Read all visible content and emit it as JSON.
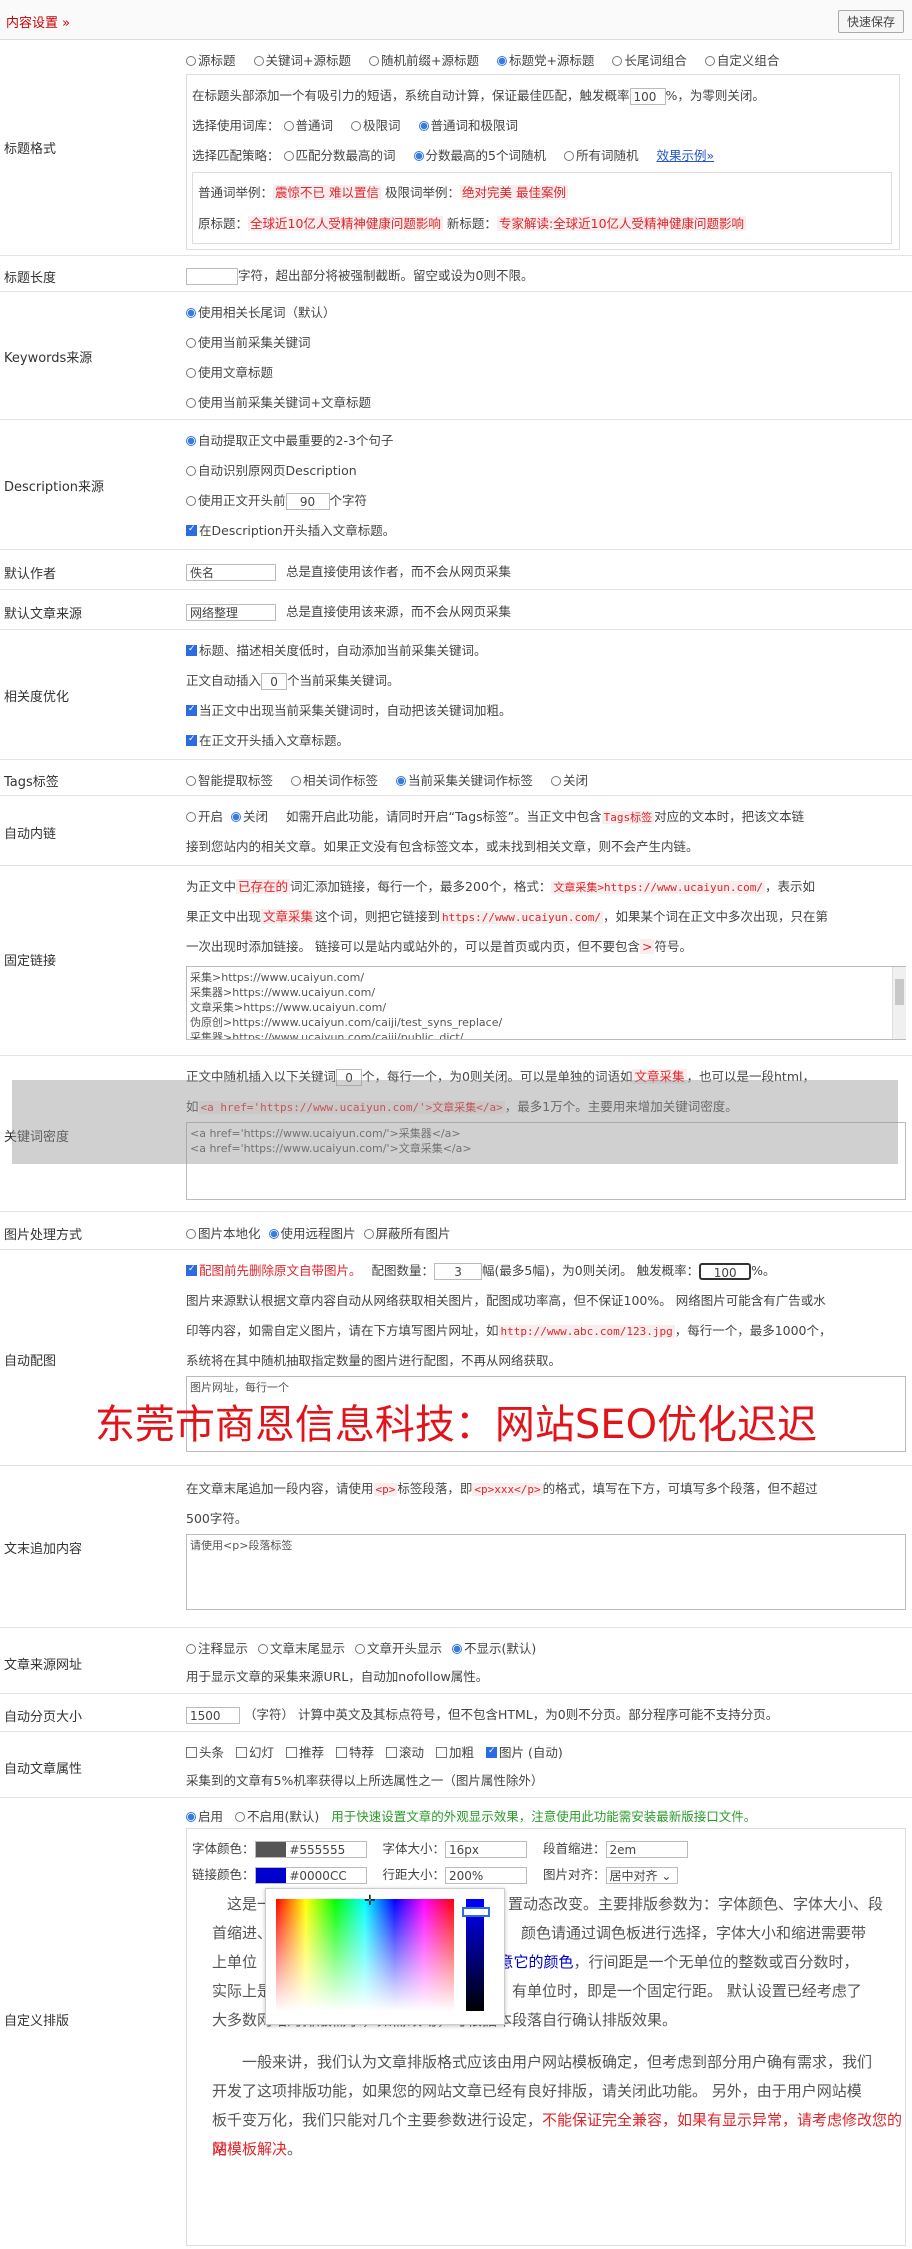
{
  "header": {
    "title": "内容设置",
    "title_arrow": "»",
    "save_label": "快速保存"
  },
  "title_format": {
    "label": "标题格式",
    "options": [
      "源标题",
      "关键词+源标题",
      "随机前缀+源标题",
      "标题党+源标题",
      "长尾词组合",
      "自定义组合"
    ],
    "selected": 3,
    "desc_pre": "在标题头部添加一个有吸引力的短语，系统自动计算，保证最佳匹配，触发概率",
    "prob": "100",
    "desc_post": "%，为零则关闭。",
    "lexicon_label": "选择使用词库：",
    "lexicon_options": [
      "普通词",
      "极限词",
      "普通词和极限词"
    ],
    "lexicon_selected": 2,
    "strategy_label": "选择匹配策略：",
    "strategy_options": [
      "匹配分数最高的词",
      "分数最高的5个词随机",
      "所有词随机"
    ],
    "strategy_selected": 1,
    "example_link": "效果示例",
    "example_arrow": "»",
    "ex1_label": "普通词举例：",
    "ex1_value": "震惊不已  难以置信",
    "ex2_label": "极限词举例：",
    "ex2_value": "绝对完美  最佳案例",
    "ex3_label": "原标题：",
    "ex3_value": "全球近10亿人受精神健康问题影响",
    "ex4_label": "新标题：",
    "ex4_value": "专家解读:全球近10亿人受精神健康问题影响"
  },
  "title_length": {
    "label": "标题长度",
    "value": "",
    "unit": "字符，超出部分将被强制截断。留空或设为0则不限。"
  },
  "keywords_source": {
    "label": "Keywords来源",
    "options": [
      "使用相关长尾词（默认）",
      "使用当前采集关键词",
      "使用文章标题",
      "使用当前采集关键词+文章标题"
    ],
    "selected": 0
  },
  "description_source": {
    "label": "Description来源",
    "opt1": "自动提取正文中最重要的2-3个句子",
    "opt2": "自动识别原网页Description",
    "opt3_pre": "使用正文开头前",
    "opt3_value": "90",
    "opt3_post": "个字符",
    "chk": "在Description开头插入文章标题。"
  },
  "default_author": {
    "label": "默认作者",
    "value": "佚名",
    "hint": "总是直接使用该作者，而不会从网页采集"
  },
  "default_source": {
    "label": "默认文章来源",
    "value": "网络整理",
    "hint": "总是直接使用该来源，而不会从网页采集"
  },
  "relevance": {
    "label": "相关度优化",
    "chk1": "标题、描述相关度低时，自动添加当前采集关键词。",
    "line2_pre": "正文自动插入",
    "line2_value": "0",
    "line2_post": "个当前采集关键词。",
    "chk3": "当正文中出现当前采集关键词时，自动把该关键词加粗。",
    "chk4": "在正文开头插入文章标题。"
  },
  "tags": {
    "label": "Tags标签",
    "options": [
      "智能提取标签",
      "相关词作标签",
      "当前采集关键词作标签",
      "关闭"
    ],
    "selected": 2
  },
  "auto_link": {
    "label": "自动内链",
    "options": [
      "开启",
      "关闭"
    ],
    "selected": 1,
    "hint1_pre": "如需开启此功能，请同时开启“Tags标签”。当正文中包含",
    "hint1_tag": "Tags标签",
    "hint1_post": "对应的文本时，把该文本链",
    "hint2": "接到您站内的相关文章。如果正文没有包含标签文本，或未找到相关文章，则不会产生内链。"
  },
  "fixed_link": {
    "label": "固定链接",
    "l1_a": "为正文中",
    "l1_b": "已存在的",
    "l1_c": "词汇添加链接，每行一个，最多200个，格式：",
    "l1_d": "文章采集>https://www.ucaiyun.com/",
    "l1_e": "，表示如",
    "l2_a": "果正文中出现",
    "l2_b": "文章采集",
    "l2_c": "这个词，则把它链接到",
    "l2_d": "https://www.ucaiyun.com/",
    "l2_e": "，如果某个词在正文中多次出现，只在第",
    "l3_a": "一次出现时添加链接。 链接可以是站内或站外的，可以是首页或内页，但不要包含",
    "l3_b": ">",
    "l3_c": "符号。",
    "textarea": [
      "采集>https://www.ucaiyun.com/",
      "采集器>https://www.ucaiyun.com/",
      "文章采集>https://www.ucaiyun.com/",
      "伪原创>https://www.ucaiyun.com/caiji/test_syns_replace/",
      "采集器>https://www.ucaiyun.com/caiji/public_dict/"
    ]
  },
  "keyword_density": {
    "label": "关键词密度",
    "l1_pre": "正文中随机插入以下关键词",
    "l1_value": "0",
    "l1_mid": "个，每行一个，为0则关闭。可以是单独的词语如",
    "l1_tag": "文章采集",
    "l1_post": "，也可以是一段html，",
    "l2_pre": "如",
    "l2_code": "<a href='https://www.ucaiyun.com/'>文章采集</a>",
    "l2_post": "，最多1万个。主要用来增加关键词密度。",
    "textarea": [
      "<a href='https://www.ucaiyun.com/'>采集器</a>",
      "<a href='https://www.ucaiyun.com/'>文章采集</a>"
    ]
  },
  "image_mode": {
    "label": "图片处理方式",
    "options": [
      "图片本地化",
      "使用远程图片",
      "屏蔽所有图片"
    ],
    "selected": 1
  },
  "auto_image": {
    "label": "自动配图",
    "chk_label": "配图前先删除原文自带图片。",
    "count_pre": "配图数量：",
    "count_value": "3",
    "count_post": "幅(最多5幅)，为0则关闭。 触发概率：",
    "prob_value": "100",
    "prob_post": "%。",
    "l2": "图片来源默认根据文章内容自动从网络获取相关图片，配图成功率高，但不保证100%。 网络图片可能含有广告或水",
    "l3_pre": "印等内容，如需自定义图片，请在下方填写图片网址，如",
    "l3_code": "http://www.abc.com/123.jpg",
    "l3_post": "，每行一个，最多1000个，",
    "l4": "系统将在其中随机抽取指定数量的图片进行配图，不再从网络获取。",
    "placeholder": "图片网址，每行一个"
  },
  "watermark": "东莞市商恩信息科技：网站SEO优化迟迟",
  "append_content": {
    "label": "文末追加内容",
    "l1_pre": "在文章末尾追加一段内容，请使用",
    "l1_tag": "<p>",
    "l1_mid": "标签段落，即",
    "l1_code": "<p>xxx</p>",
    "l1_post": "的格式，填写在下方，可填写多个段落，但不超过",
    "l2": "500字符。",
    "placeholder": "请使用<p>段落标签"
  },
  "source_url": {
    "label": "文章来源网址",
    "options": [
      "注释显示",
      "文章末尾显示",
      "文章开头显示",
      "不显示(默认)"
    ],
    "selected": 3,
    "hint": "用于显示文章的采集来源URL，自动加nofollow属性。"
  },
  "pagination": {
    "label": "自动分页大小",
    "value": "1500",
    "hint": "（字符） 计算中英文及其标点符号，但不包含HTML，为0则不分页。部分程序可能不支持分页。"
  },
  "article_attr": {
    "label": "自动文章属性",
    "options": [
      "头条",
      "幻灯",
      "推荐",
      "特荐",
      "滚动",
      "加粗",
      "图片 (自动)"
    ],
    "checked": [
      6
    ],
    "hint": "采集到的文章有5%机率获得以上所选属性之一（图片属性除外）"
  },
  "custom_layout": {
    "label": "自定义排版",
    "options": [
      "启用",
      "不启用(默认)"
    ],
    "selected": 0,
    "notice": "用于快速设置文章的外观显示效果，注意使用此功能需安装最新版接口文件。",
    "font_color_label": "字体颜色：",
    "font_color_value": "#555555",
    "font_size_label": "字体大小：",
    "font_size_value": "16px",
    "indent_label": "段首缩进：",
    "indent_value": "2em",
    "link_color_label": "链接颜色：",
    "link_color_value": "#0000CC",
    "line_height_label": "行距大小：",
    "line_height_value": "200%",
    "align_label": "图片对齐：",
    "align_value": "居中对齐",
    "p1_l1_a": "这是一",
    "p1_l1_b": "置动态改变。主要排版参数为：字体颜色、字体大小、段",
    "p1_l2_a": "首缩进、链",
    "p1_l2_b": "颜色请通过调色板进行选择，字体大小和缩进需要带",
    "p1_l3_a": "上单位（p",
    "p1_l3_link": "注意它的颜色",
    "p1_l3_b": "，行间距是一个无单位的整数或百分数时，",
    "p1_l4": "实际上是一个以字体大小为基数的行距倍数；有单位时，即是一个固定行距。 默认设置已经考虑了",
    "p1_l5": "大多数网站的排版需求，如需改动，可根据本段落自行确认排版效果。",
    "p2_l1": "一般来讲，我们认为文章排版格式应该由用户网站模板确定，但考虑到部分用户确有需求，我们",
    "p2_l2": "开发了这项排版功能，如果您的网站文章已经有良好排版，请关闭此功能。 另外，由于用户网站模",
    "p2_l3_a": "板千变万化，我们只能对几个主要参数进行设定，",
    "p2_l3_b": "不能保证完全兼容，如果有显示异常，请考虑修改您的网",
    "p2_l4_a": "站模板解决",
    "p2_l4_b": "。"
  },
  "colors": {
    "accent": "#e0252b",
    "link": "#2255cc",
    "font_swatch": "#555555",
    "link_swatch": "#0000CC"
  }
}
